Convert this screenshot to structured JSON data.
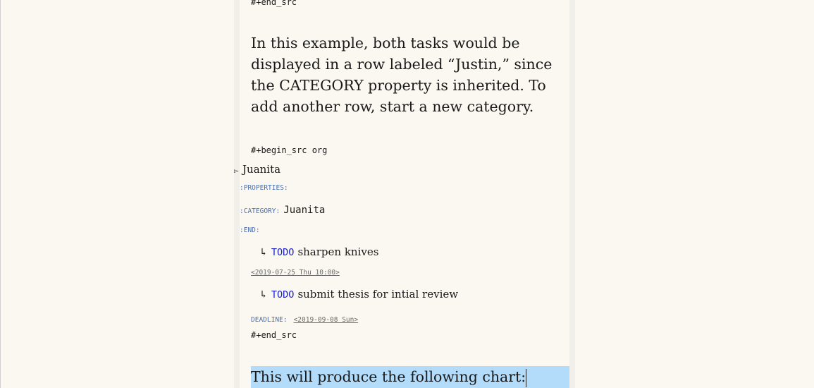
{
  "editor": {
    "end_src_top": "#+end_src",
    "paragraph": "In this example, both tasks would be displayed in a row labeled “Justin,” since the CATEGORY property is inherited. To add another row, start a new category.",
    "begin_src": "#+begin_src org",
    "heading_marker": "▻",
    "heading": "Juanita",
    "properties_key": ":PROPERTIES:",
    "category_key": ":CATEGORY:",
    "category_value": "Juanita",
    "end_key": ":END:",
    "tasks": [
      {
        "arrow": "↳",
        "keyword": "TODO",
        "text": "sharpen knives"
      },
      {
        "arrow": "↳",
        "keyword": "TODO",
        "text": "submit thesis for intial review"
      }
    ],
    "scheduled_timestamp": "<2019-07-25 Thu 10:00>",
    "deadline_key": "DEADLINE:",
    "deadline_timestamp": "<2019-09-08 Sun>",
    "end_src_bottom": "#+end_src",
    "highlighted_sentence": "This will produce the following chart:"
  }
}
